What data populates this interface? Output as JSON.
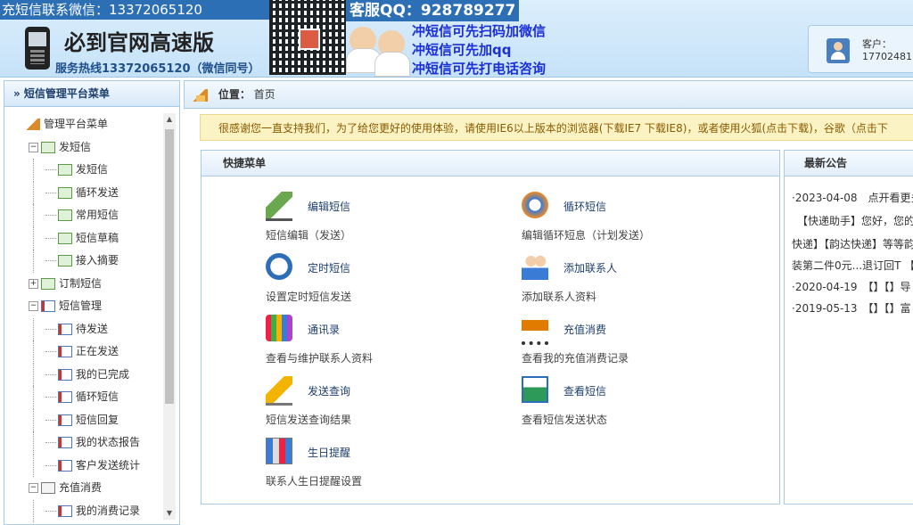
{
  "header": {
    "wechat_strip": "充短信联系微信：13372065120",
    "site_title": "必到官网高速版",
    "hotline": "服务热线13372065120（微信同号）",
    "qq_banner": "客服QQ：928789277",
    "promo_lines": [
      "冲短信可先扫码加微信",
      "冲短信可先加qq",
      "冲短信可先打电话咨询"
    ],
    "customer_label": "客户：",
    "customer_id": "17702481"
  },
  "sidebar": {
    "title": "» 短信管理平台菜单",
    "tree": [
      {
        "label": "管理平台菜单",
        "level": 0,
        "icon": "home-icon"
      },
      {
        "label": "发短信",
        "level": 1,
        "toggle": "−",
        "icon": "mail-icon"
      },
      {
        "label": "发短信",
        "level": 2,
        "icon": "send-mail-icon"
      },
      {
        "label": "循环发送",
        "level": 2,
        "icon": "send-mail-icon"
      },
      {
        "label": "常用短信",
        "level": 2,
        "icon": "send-mail-icon"
      },
      {
        "label": "短信草稿",
        "level": 2,
        "icon": "send-mail-icon"
      },
      {
        "label": "接入摘要",
        "level": 2,
        "icon": "send-mail-icon"
      },
      {
        "label": "订制短信",
        "level": 1,
        "toggle": "+",
        "icon": "mail-icon"
      },
      {
        "label": "短信管理",
        "level": 1,
        "toggle": "−",
        "icon": "folder-icon"
      },
      {
        "label": "待发送",
        "level": 2,
        "icon": "list-icon"
      },
      {
        "label": "正在发送",
        "level": 2,
        "icon": "list-icon"
      },
      {
        "label": "我的已完成",
        "level": 2,
        "icon": "list-icon"
      },
      {
        "label": "循环短信",
        "level": 2,
        "icon": "list-icon"
      },
      {
        "label": "短信回复",
        "level": 2,
        "icon": "list-icon"
      },
      {
        "label": "我的状态报告",
        "level": 2,
        "icon": "list-icon"
      },
      {
        "label": "客户发送统计",
        "level": 2,
        "icon": "list-icon"
      },
      {
        "label": "充值消费",
        "level": 1,
        "toggle": "−",
        "icon": "cart-icon"
      },
      {
        "label": "我的消费记录",
        "level": 2,
        "icon": "list-icon"
      }
    ],
    "scroll_up": "▲",
    "scroll_down": "▼"
  },
  "location": {
    "label": "位置：",
    "value": "首页"
  },
  "notice": "很感谢您一直支持我们，为了给您更好的使用体验，请使用IE6以上版本的浏览器(下载IE7 下载IE8)，或者使用火狐(点击下载)，谷歌（点击下",
  "quick_menu": {
    "title": "快捷菜单",
    "items": [
      {
        "name": "编辑短信",
        "desc": "短信编辑（发送）",
        "icon": "edit-sms-icon"
      },
      {
        "name": "循环短信",
        "desc": "编辑循环短息（计划发送）",
        "icon": "cycle-sms-icon"
      },
      {
        "name": "定时短信",
        "desc": "设置定时短信发送",
        "icon": "alarm-clock-icon"
      },
      {
        "name": "添加联系人",
        "desc": "添加联系人资料",
        "icon": "add-contact-icon"
      },
      {
        "name": "通讯录",
        "desc": "查看与维护联系人资料",
        "icon": "address-book-icon"
      },
      {
        "name": "充值消费",
        "desc": "查看我的充值消费记录",
        "icon": "shopping-cart-icon"
      },
      {
        "name": "发送查询",
        "desc": "短信发送查询结果",
        "icon": "send-query-icon"
      },
      {
        "name": "查看短信",
        "desc": "查看短信发送状态",
        "icon": "view-sms-icon"
      },
      {
        "name": "生日提醒",
        "desc": "联系人生日提醒设置",
        "icon": "birthday-icon"
      }
    ]
  },
  "announcements": {
    "title": "最新公告",
    "lines": [
      "·2023-04-08　点开看更多",
      "　【快递助手】您好，您的",
      "快递】【韵达快递】等等韵",
      "装第二件0元...退订回T 【",
      "·2020-04-19　【】【】导",
      "·2019-05-13　【】【】富"
    ]
  }
}
